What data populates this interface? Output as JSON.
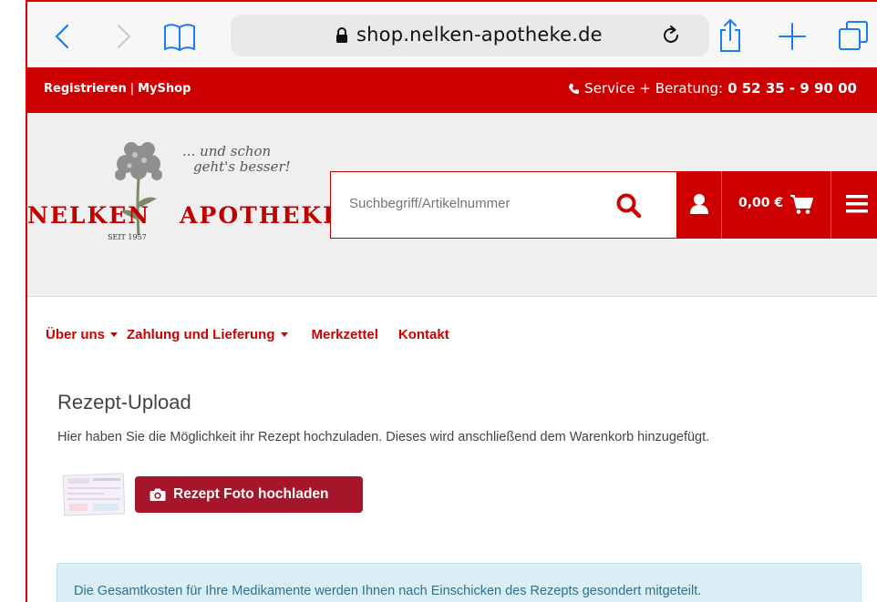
{
  "browser": {
    "url": "shop.nelken-apotheke.de",
    "accent": "#1a7cf5"
  },
  "topbar": {
    "register": "Registrieren",
    "separator": "|",
    "myshop": "MyShop",
    "service_label": "Service + Beratung:",
    "phone": "0 52 35 - 9 90 00"
  },
  "logo": {
    "name_left": "NELKEN",
    "name_right": "APOTHEKE",
    "slogan_line1": "... und schon",
    "slogan_line2": "geht's besser!",
    "since": "SEIT 1957"
  },
  "search": {
    "placeholder": "Suchbegriff/Artikelnummer"
  },
  "cart": {
    "amount": "0,00 €"
  },
  "nav": {
    "items": [
      {
        "label": "Über uns"
      },
      {
        "label": "Zahlung und Lieferung"
      },
      {
        "label": "Merkzettel"
      },
      {
        "label": "Kontakt"
      }
    ]
  },
  "content": {
    "title": "Rezept-Upload",
    "description": "Hier haben Sie die Möglichkeit ihr Rezept hochzuladen. Dieses wird anschließend dem Warenkorb hinzugefügt.",
    "upload_button": "Rezept Foto hochladen",
    "info": "Die Gesamtkosten für Ihre Medikamente werden Ihnen nach Einschicken des Rezepts gesondert mitgeteilt."
  },
  "colors": {
    "brand_red": "#cc0000",
    "button_red": "#a5162a",
    "info_bg": "#d9eef5"
  }
}
